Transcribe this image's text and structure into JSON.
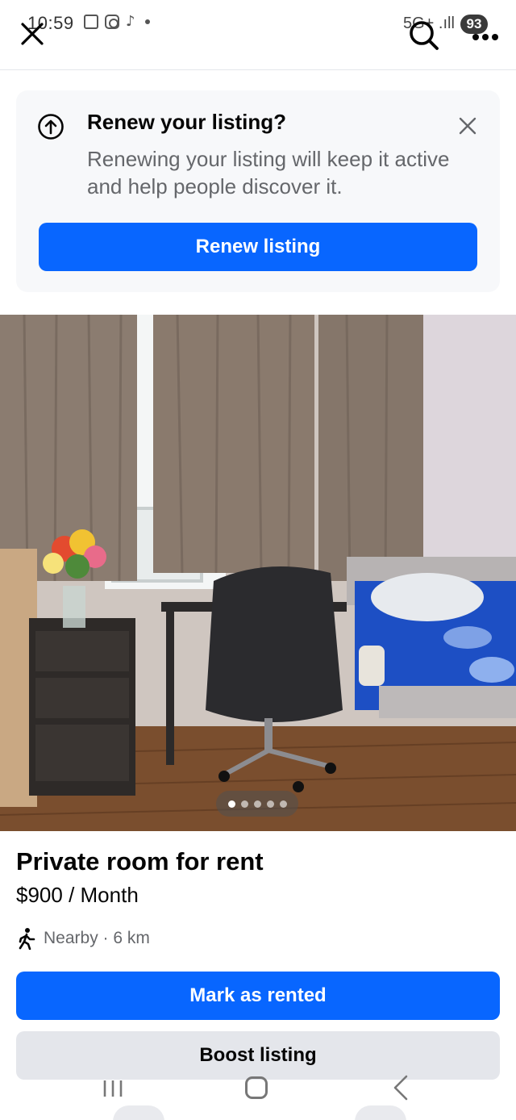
{
  "status_bar": {
    "time": "10:59",
    "signal_text": "5G+ .ıll",
    "battery": "93"
  },
  "header": {
    "close_icon": "close-icon",
    "search_icon": "search-icon",
    "more_icon": "more-icon"
  },
  "renew_card": {
    "title": "Renew your listing?",
    "description": "Renewing your listing will keep it active and help people discover it.",
    "button_label": "Renew listing"
  },
  "photo": {
    "total_images": 5,
    "current_index": 1
  },
  "listing": {
    "title": "Private room for rent",
    "price": "$900 / Month",
    "location": "Nearby · 6 km"
  },
  "actions": {
    "mark_rented_label": "Mark as rented",
    "boost_label": "Boost listing"
  },
  "colors": {
    "primary": "#0866ff",
    "secondary_button": "#e4e6eb",
    "card_bg": "#f7f8fa",
    "muted_text": "#65676b"
  }
}
